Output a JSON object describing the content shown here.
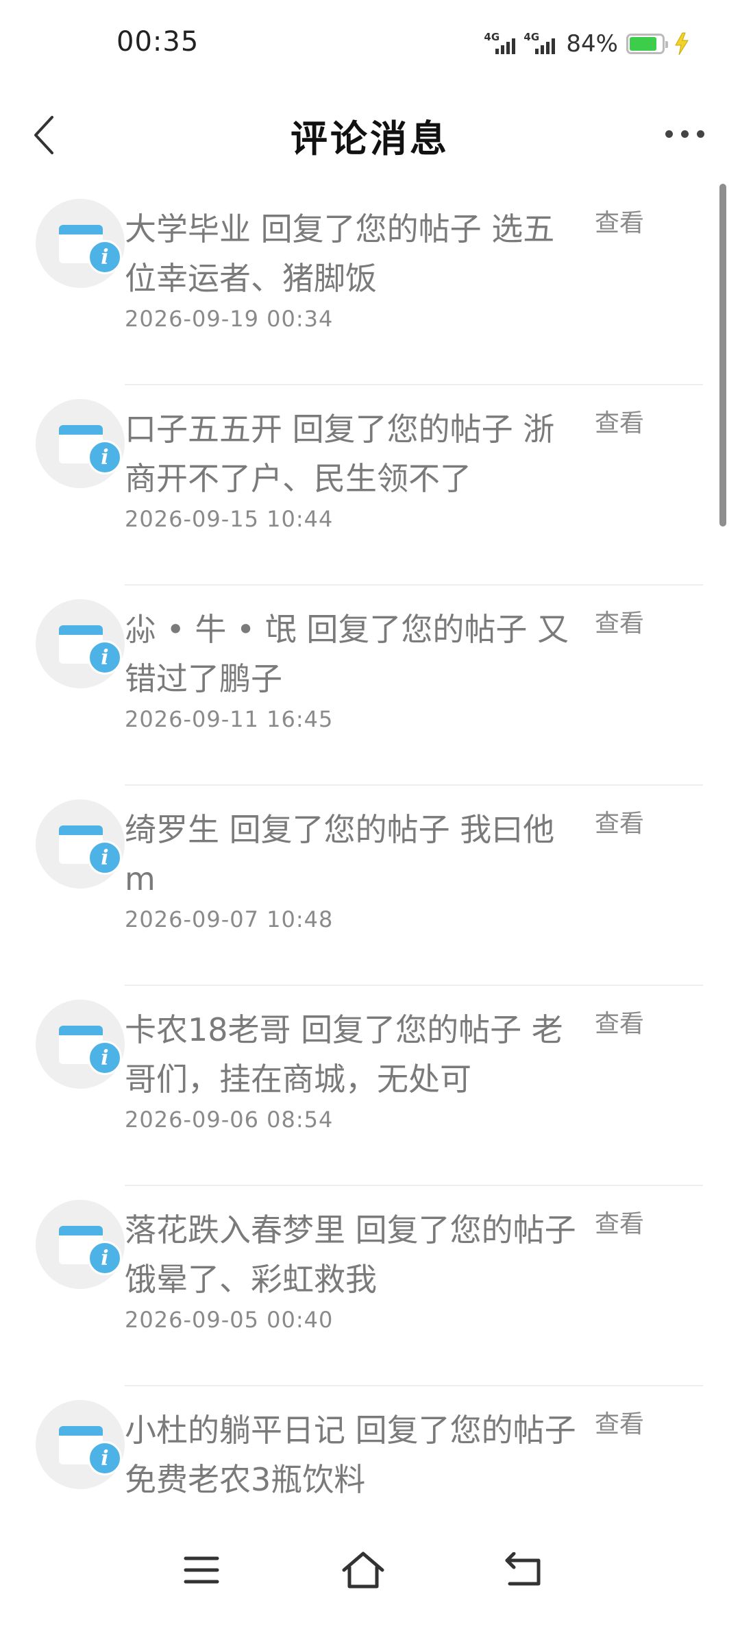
{
  "status_bar": {
    "time": "00:35",
    "network_1": "4G",
    "network_2": "4G",
    "battery_text": "84%",
    "battery_level": 0.84,
    "battery_color": "#3cce4b",
    "icons": [
      "signal-icon",
      "signal-icon",
      "battery-icon",
      "charging-bolt-icon"
    ]
  },
  "header": {
    "title": "评论消息",
    "back_icon": "chevron-left-icon",
    "more_icon": "more-dots-icon"
  },
  "messages": [
    {
      "name": "大学毕业",
      "action": "回复了您的帖子",
      "content": "选五位幸运者、猪脚饭",
      "time": "2026-09-19 00:34",
      "view_label": "查看"
    },
    {
      "name": "口子五五开",
      "action": "回复了您的帖子",
      "content": "浙商开不了户、民生领不了",
      "time": "2026-09-15 10:44",
      "view_label": "查看"
    },
    {
      "name": "尛 • 牛 • 氓",
      "action": "回复了您的帖子",
      "content": "又错过了鹏子",
      "time": "2026-09-11 16:45",
      "view_label": "查看"
    },
    {
      "name": "绮罗生",
      "action": "回复了您的帖子",
      "content": "我曰他m",
      "time": "2026-09-07 10:48",
      "view_label": "查看"
    },
    {
      "name": "卡农18老哥",
      "action": "回复了您的帖子",
      "content": "老哥们，挂在商城，无处可",
      "time": "2026-09-06 08:54",
      "view_label": "查看"
    },
    {
      "name": "落花跌入春梦里",
      "action": "回复了您的帖子",
      "content": "饿晕了、彩虹救我",
      "time": "2026-09-05 00:40",
      "view_label": "查看"
    },
    {
      "name": "小杜的躺平日记",
      "action": "回复了您的帖子",
      "content": "免费老农3瓶饮料",
      "time": "",
      "view_label": "查看"
    }
  ],
  "accent_color": "#4db3e6",
  "nav": {
    "icons": [
      "menu-icon",
      "home-icon",
      "back-arrow-icon"
    ]
  }
}
